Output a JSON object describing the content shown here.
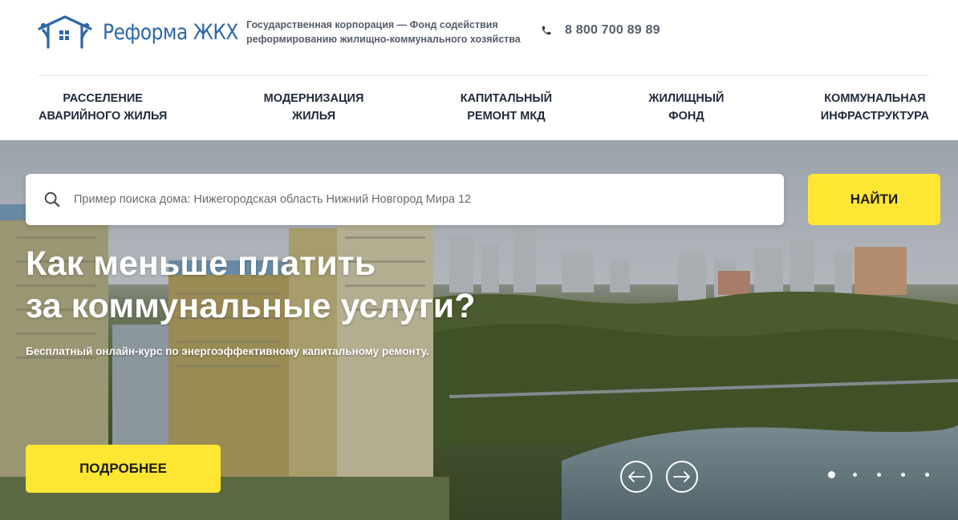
{
  "header": {
    "logo_text": "Реформа ЖКХ",
    "tagline_line1": "Государственная корпорация — Фонд содействия",
    "tagline_line2": "реформированию жилищно-коммунального хозяйства",
    "phone": "8 800 700 89 89",
    "phone_icon": "phone-icon"
  },
  "nav": [
    {
      "line1": "РАССЕЛЕНИЕ",
      "line2": "АВАРИЙНОГО ЖИЛЬЯ"
    },
    {
      "line1": "МОДЕРНИЗАЦИЯ",
      "line2": "ЖИЛЬЯ"
    },
    {
      "line1": "КАПИТАЛЬНЫЙ",
      "line2": "РЕМОНТ МКД"
    },
    {
      "line1": "ЖИЛИЩНЫЙ",
      "line2": "ФОНД"
    },
    {
      "line1": "КОММУНАЛЬНАЯ",
      "line2": "ИНФРАСТРУКТУРА"
    }
  ],
  "search": {
    "placeholder": "Пример поиска дома: Нижегородская область Нижний Новгород Мира 12",
    "value": "",
    "button_label": "НАЙТИ",
    "icon": "search-icon"
  },
  "hero": {
    "title_line1": "Как меньше платить",
    "title_line2": "за коммунальные услуги?",
    "subtitle": "Бесплатный онлайн-курс по энергоэффективному капитальному ремонту.",
    "button_label": "ПОДРОБНЕЕ",
    "slide_count": 5,
    "active_slide": 1
  },
  "colors": {
    "accent_yellow": "#ffe633",
    "brand_blue": "#2d66a7",
    "nav_text": "#1f2a3a"
  }
}
